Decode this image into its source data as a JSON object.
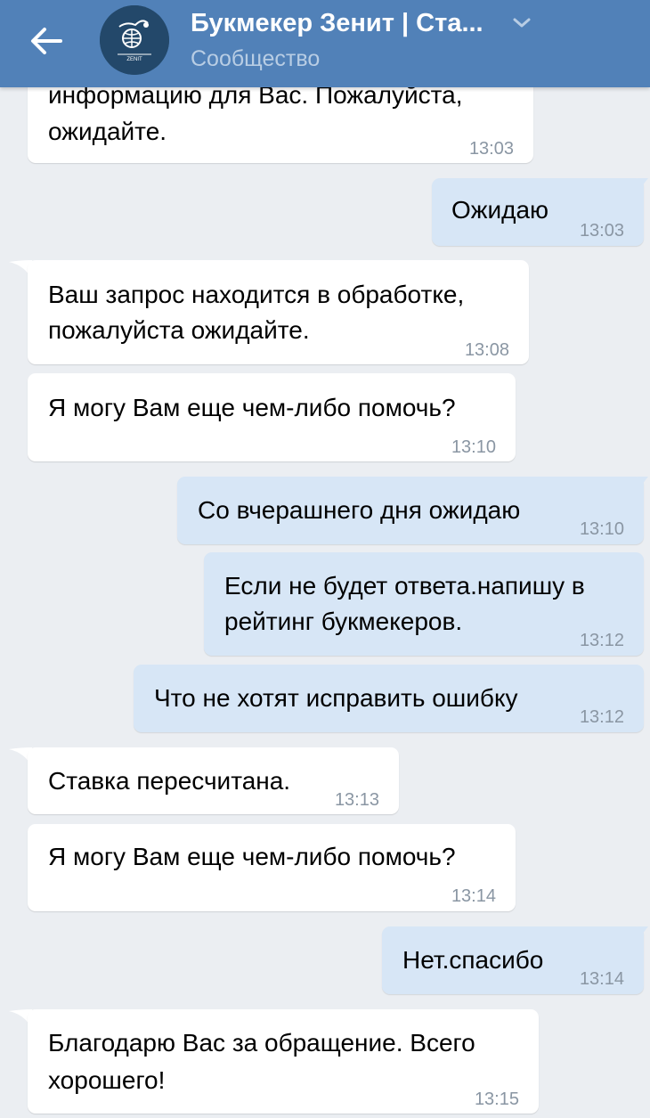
{
  "header": {
    "title": "Букмекер Зенит | Ста...",
    "subtitle": "Сообщество",
    "avatar_text": "ZENIT"
  },
  "messages": [
    {
      "side": "in",
      "lines": [
        "информацию для Вас. Пожалуйста,",
        "ожидайте."
      ],
      "time": "13:03"
    },
    {
      "side": "out",
      "lines": [
        "Ожидаю"
      ],
      "time": "13:03"
    },
    {
      "side": "in",
      "lines": [
        "Ваш запрос находится в обработке,",
        "пожалуйста ожидайте."
      ],
      "time": "13:08"
    },
    {
      "side": "in",
      "lines": [
        "Я могу Вам еще чем-либо помочь?"
      ],
      "time": "13:10"
    },
    {
      "side": "out",
      "lines": [
        "Со вчерашнего дня ожидаю"
      ],
      "time": "13:10"
    },
    {
      "side": "out",
      "lines": [
        "Если не будет ответа.напишу в",
        "рейтинг букмекеров."
      ],
      "time": "13:12"
    },
    {
      "side": "out",
      "lines": [
        "Что не хотят исправить ошибку"
      ],
      "time": "13:12"
    },
    {
      "side": "in",
      "lines": [
        "Ставка пересчитана."
      ],
      "time": "13:13"
    },
    {
      "side": "in",
      "lines": [
        "Я могу Вам еще чем-либо помочь?"
      ],
      "time": "13:14"
    },
    {
      "side": "out",
      "lines": [
        "Нет.спасибо"
      ],
      "time": "13:14"
    },
    {
      "side": "in",
      "lines": [
        "Благодарю Вас за обращение. Всего",
        "хорошего!"
      ],
      "time": "13:15"
    }
  ]
}
